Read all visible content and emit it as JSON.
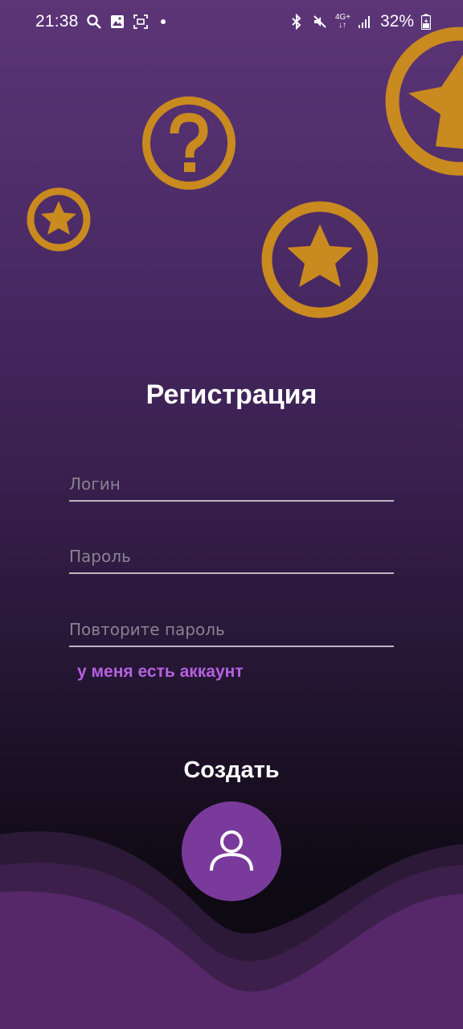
{
  "status_bar": {
    "time": "21:38",
    "left_icons": [
      "search-icon",
      "image-icon",
      "screen-capture-icon",
      "dot-icon"
    ],
    "right_icons": [
      "bluetooth-icon",
      "mute-icon",
      "4g-icon",
      "signal-icon",
      "battery-icon"
    ],
    "network_label": "4G+",
    "battery": "32%"
  },
  "decorations": [
    "star-medal-icon",
    "question-medal-icon",
    "star-medal-icon",
    "star-medal-icon"
  ],
  "screen": {
    "title": "Регистрация",
    "login_placeholder": "Логин",
    "password_placeholder": "Пароль",
    "repeat_password_placeholder": "Повторите пароль",
    "have_account_link": "у меня есть аккаунт",
    "create_label": "Создать"
  },
  "colors": {
    "accent_gold": "#c98a1f",
    "button_purple": "#7a3a9b",
    "link_purple": "#b560e0",
    "wave_purple": "#56286a"
  }
}
